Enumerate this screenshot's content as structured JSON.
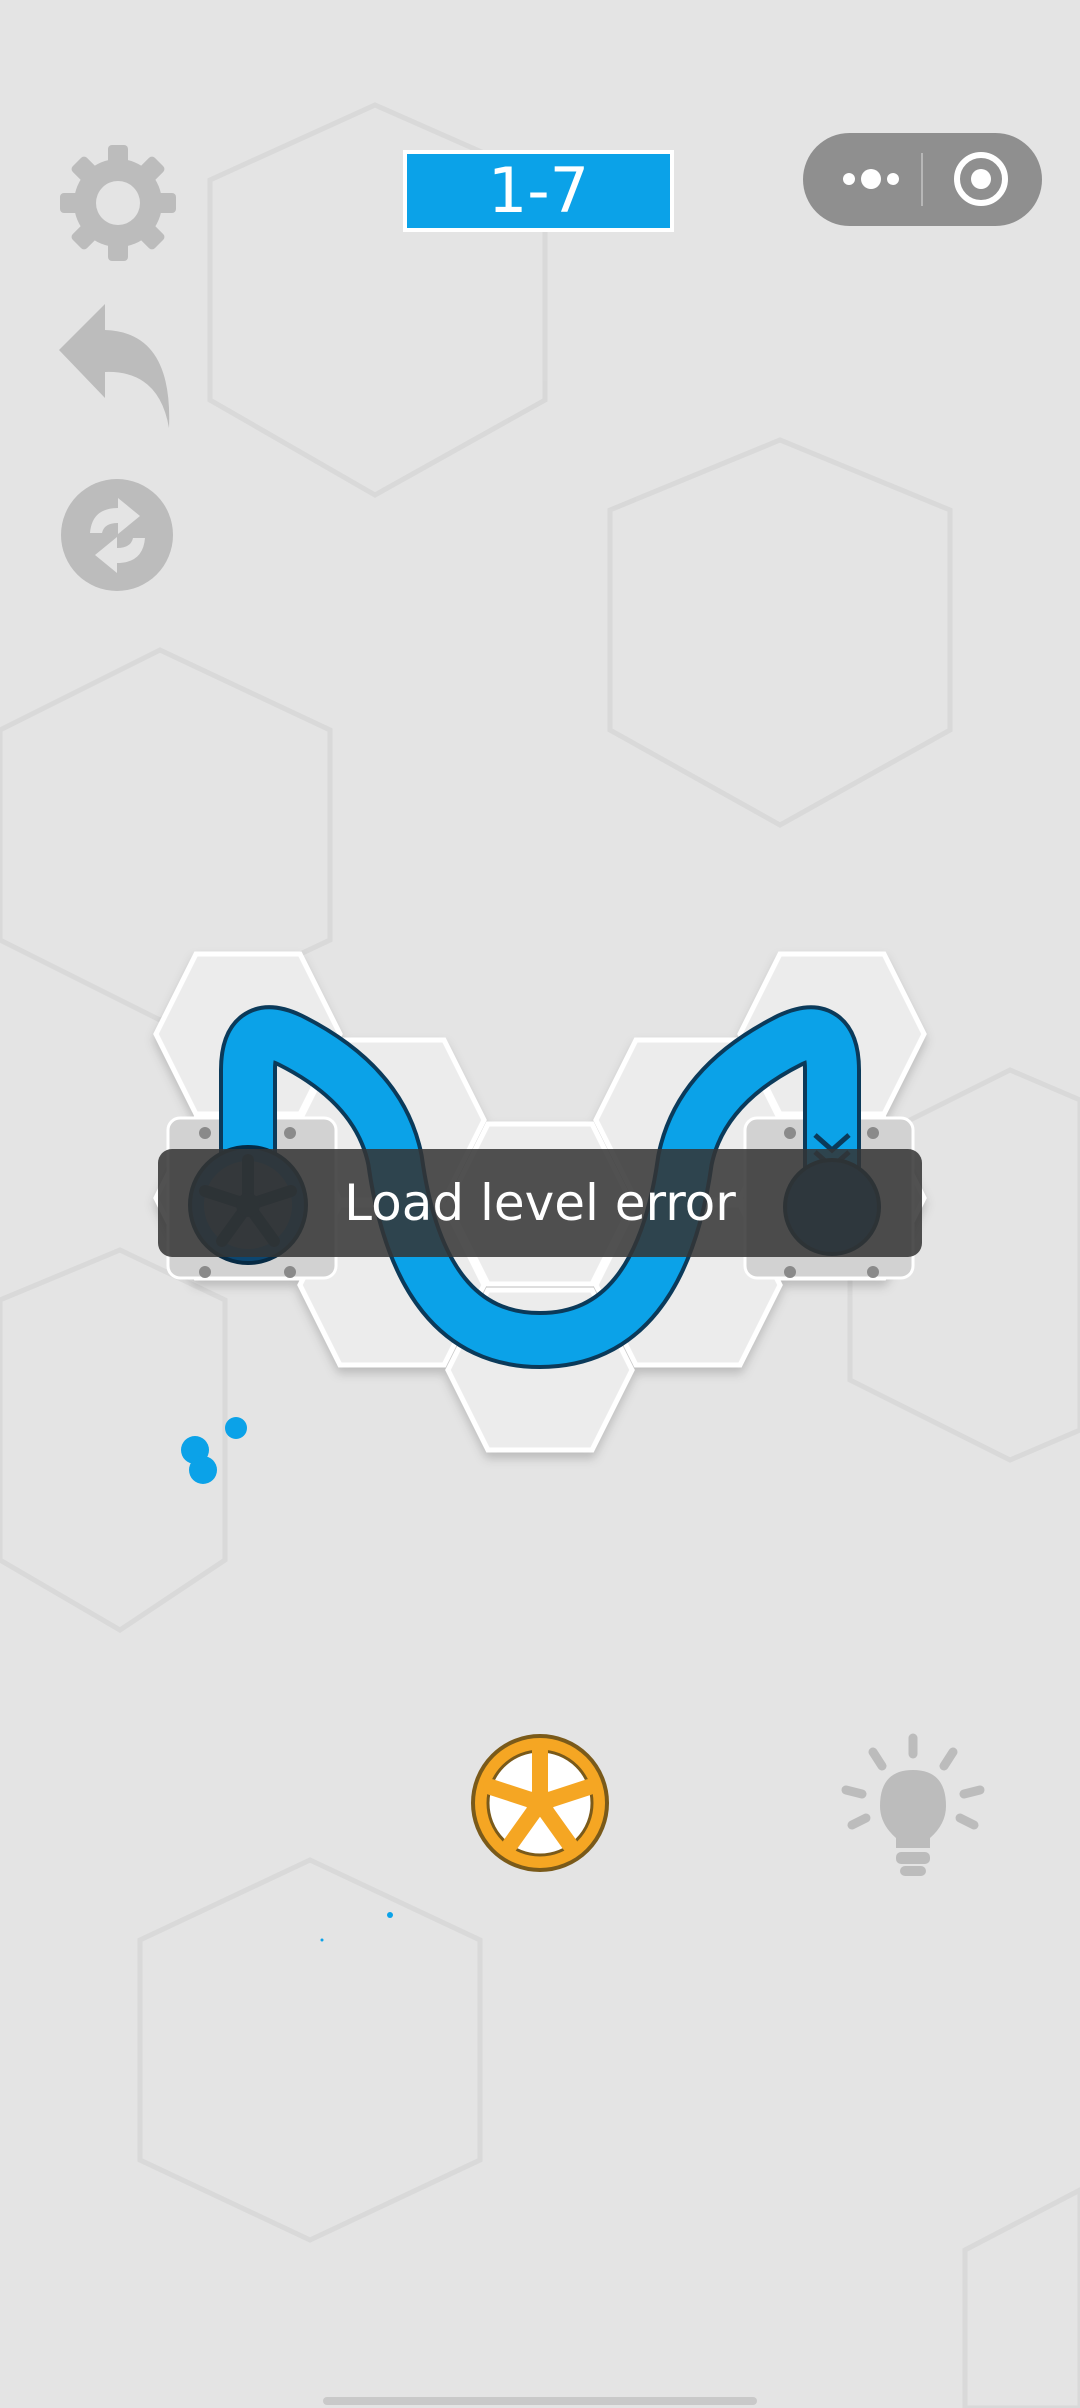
{
  "level": {
    "label": "1-7"
  },
  "toast": {
    "message": "Load level error"
  },
  "controls": {
    "settings_icon": "gear-icon",
    "undo_icon": "undo-icon",
    "restart_icon": "refresh-icon",
    "hint_icon": "lightbulb-icon",
    "menu_icon": "more-dots-icon",
    "close_icon": "target-close-icon"
  },
  "colors": {
    "background": "#e4e4e4",
    "pipe": "#0ba2e8",
    "pipe_outline": "#0b3a5a",
    "node_dark": "#0c4670",
    "wheel_orange": "#f5a623",
    "tile": "#ececec",
    "toast_bg": "#343434",
    "icon_gray": "#bcbcbc"
  }
}
